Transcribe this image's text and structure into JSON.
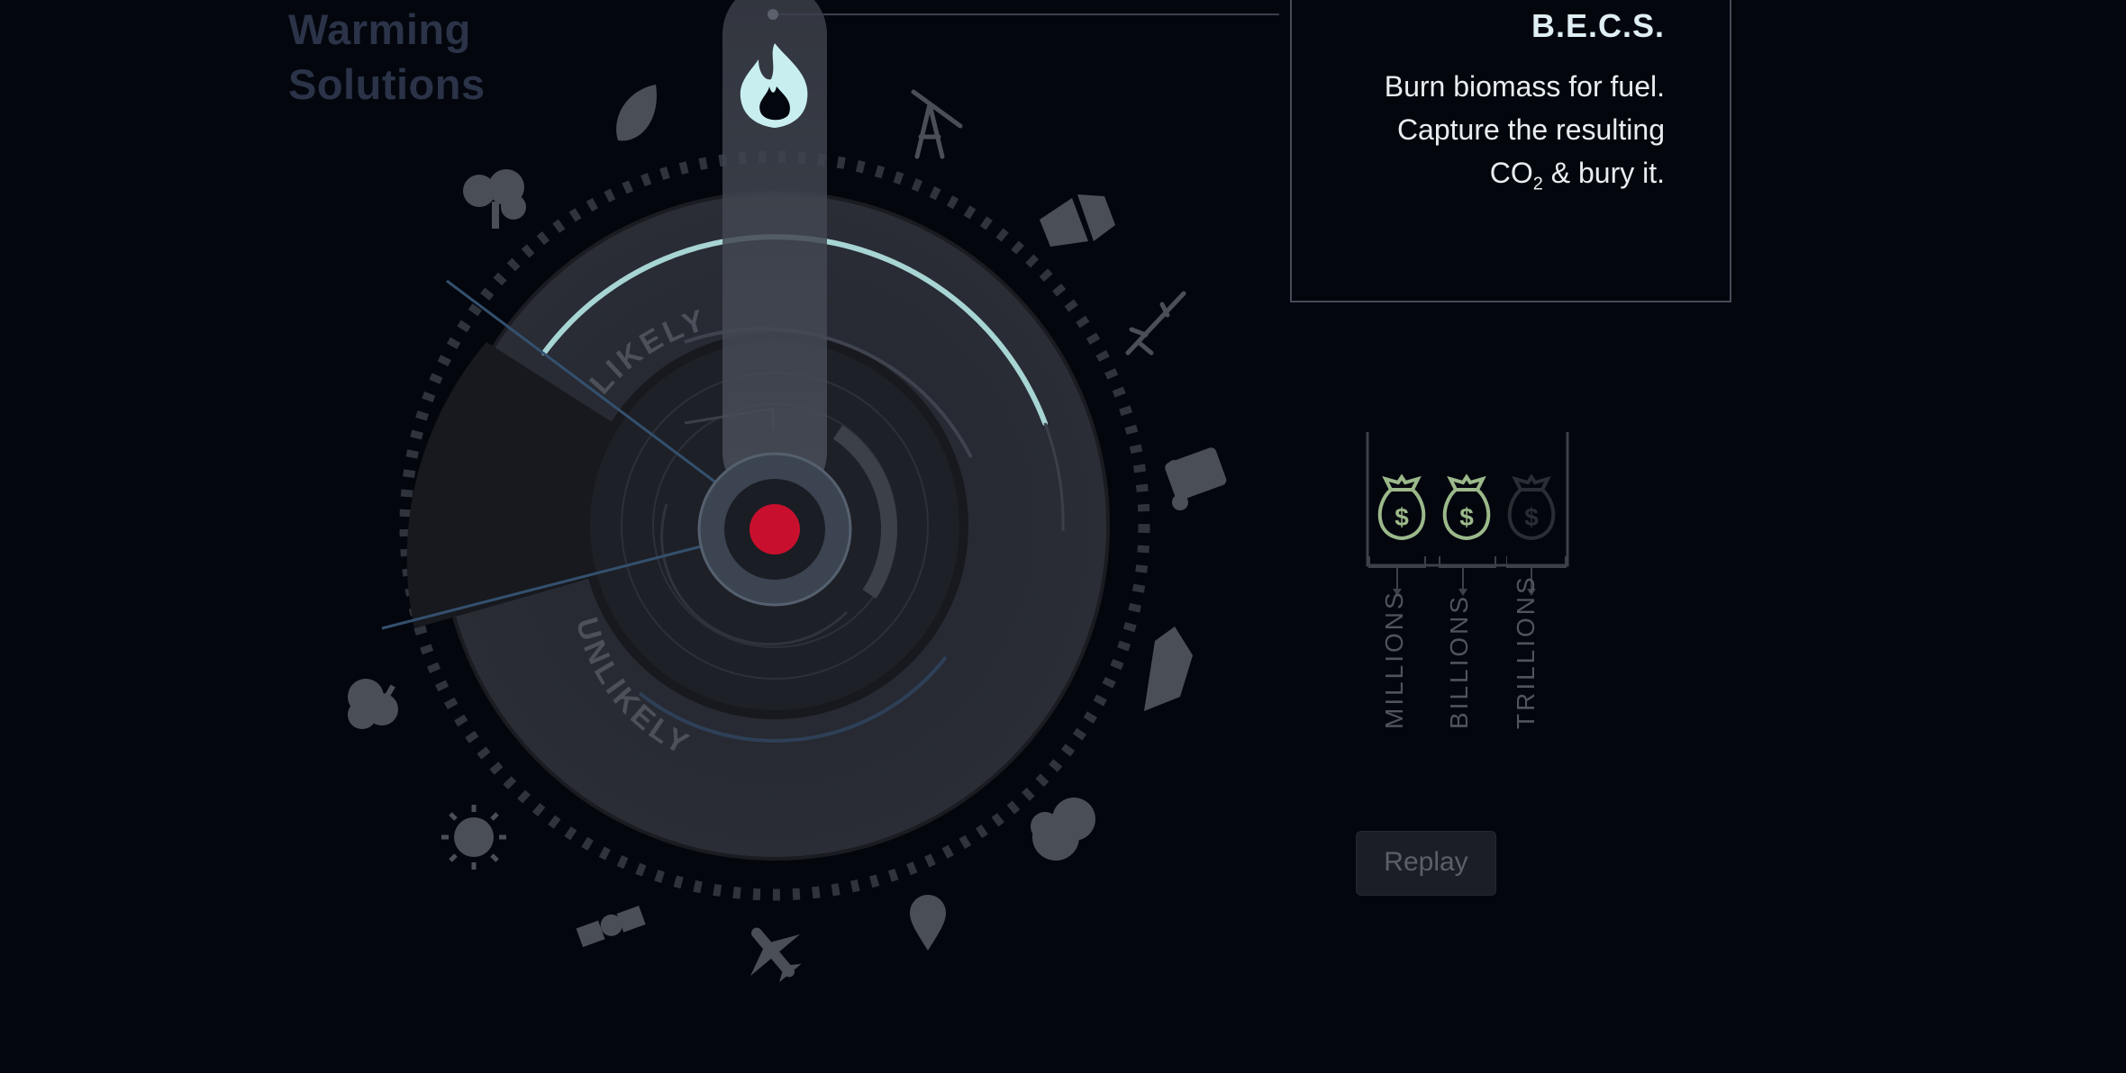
{
  "header": {
    "title_line1": "Warming",
    "title_line2": "Solutions"
  },
  "dial": {
    "likely_label": "LIKELY",
    "unlikely_label": "UNLIKELY",
    "selected_icon": "fire-icon",
    "indicator_color": "#c8102e",
    "accent_color": "#a7d5d4",
    "icons": [
      "fire-icon",
      "oil-derrick-icon",
      "buildings-icon",
      "wind-turbine-icon",
      "vehicle-icon",
      "ship-icon",
      "cloud-icon",
      "iron-pin-icon",
      "airplane-icon",
      "satellite-icon",
      "sun-icon",
      "cloud-tree-icon",
      "trees-icon",
      "leaf-icon"
    ]
  },
  "info": {
    "title": "B.E.C.S.",
    "line1": "Burn biomass for fuel.",
    "line2": "Capture the resulting",
    "line3_prefix": "CO",
    "line3_sub": "2",
    "line3_suffix": " & bury it."
  },
  "cost": {
    "scales": [
      {
        "label": "MILLIONS",
        "icon": "money-bag-icon",
        "active": true
      },
      {
        "label": "BILLIONS",
        "icon": "money-bag-icon",
        "active": true
      },
      {
        "label": "TRILLIONS",
        "icon": "money-bag-icon",
        "active": false
      }
    ],
    "active_color": "#9bb98a",
    "inactive_color": "#2a2d33"
  },
  "replay": {
    "label": "Replay"
  }
}
